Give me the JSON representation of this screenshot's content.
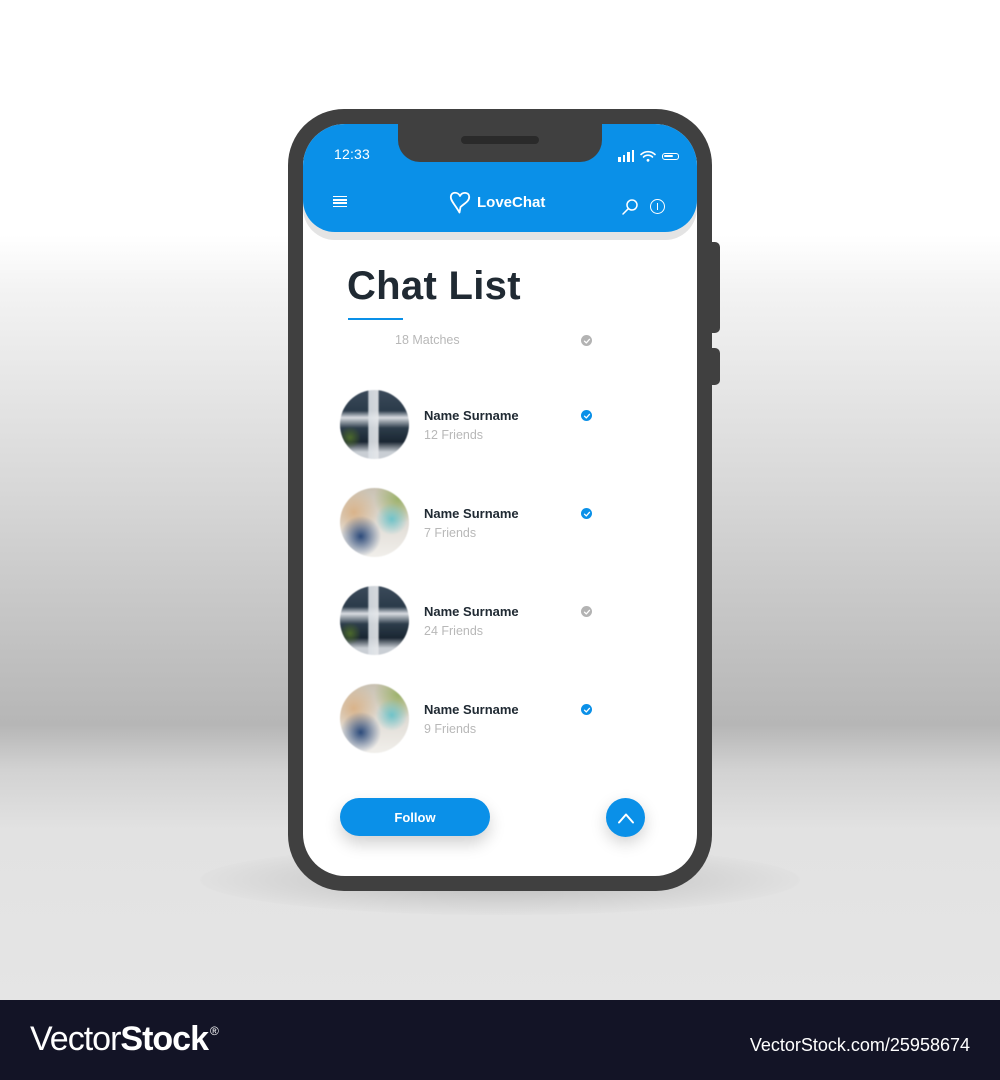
{
  "status_bar": {
    "time": "12:33",
    "icons": [
      "signal-icon",
      "wifi-icon",
      "battery-icon"
    ]
  },
  "header": {
    "app_name": "LoveChat",
    "logo_icon": "heart-icon",
    "left_icon": "menu-icon",
    "right_icons": [
      "search-icon",
      "info-icon"
    ]
  },
  "colors": {
    "accent": "#0a90e8",
    "title_text": "#202a33",
    "muted_text": "#b8b8b8",
    "phone_frame": "#404040",
    "footer_bg": "#131426"
  },
  "page": {
    "title": "Chat List",
    "matches_label": "18 Matches",
    "matches_check": "grey"
  },
  "contacts": [
    {
      "name": "Name Surname",
      "friends": "12 Friends",
      "verified": true
    },
    {
      "name": "Name Surname",
      "friends": "7 Friends",
      "verified": true
    },
    {
      "name": "Name Surname",
      "friends": "24 Friends",
      "verified": false
    },
    {
      "name": "Name Surname",
      "friends": "9 Friends",
      "verified": true
    }
  ],
  "actions": {
    "follow_label": "Follow",
    "scroll_up_icon": "chevron-up-icon"
  },
  "watermark": {
    "brand_light": "Vector",
    "brand_bold": "Stock",
    "registered": "®",
    "url": "VectorStock.com/25958674"
  }
}
